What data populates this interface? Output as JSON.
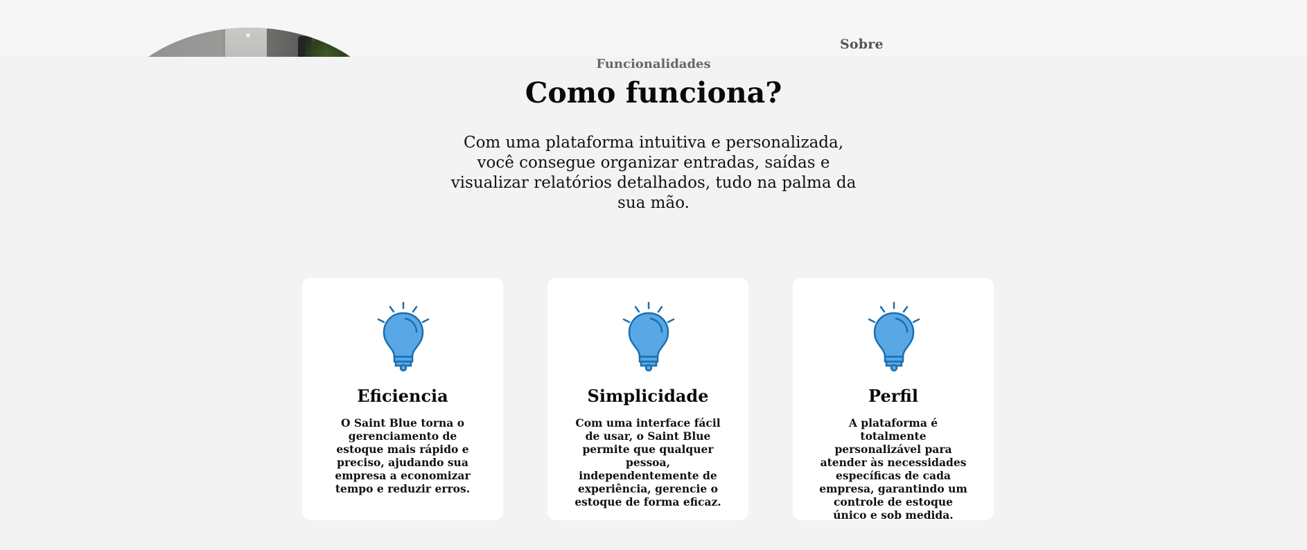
{
  "header": {
    "nav_sobre": "Sobre"
  },
  "section": {
    "eyebrow": "Funcionalidades",
    "title": "Como funciona?",
    "subtitle": "Com uma plataforma intuitiva e personalizada, você consegue organizar entradas, saídas e visualizar relatórios detalhados, tudo na palma da sua mão."
  },
  "cards": [
    {
      "icon": "lightbulb-icon",
      "title": "Eficiencia",
      "text": "O Saint Blue torna o gerenciamento de estoque mais rápido e preciso, ajudando sua empresa a economizar tempo e reduzir erros."
    },
    {
      "icon": "lightbulb-icon",
      "title": "Simplicidade",
      "text": "Com uma interface fácil de usar, o Saint Blue permite que qualquer pessoa, independentemente de experiência, gerencie o estoque de forma eficaz."
    },
    {
      "icon": "lightbulb-icon",
      "title": "Perfil",
      "text": "A plataforma é totalmente personalizável para atender às necessidades específicas de cada empresa, garantindo um controle de estoque único e sob medida."
    }
  ],
  "colors": {
    "background": "#f3f3f3",
    "card": "#ffffff",
    "bulb_fill": "#5aa7e6",
    "bulb_stroke": "#1a6fb0"
  }
}
